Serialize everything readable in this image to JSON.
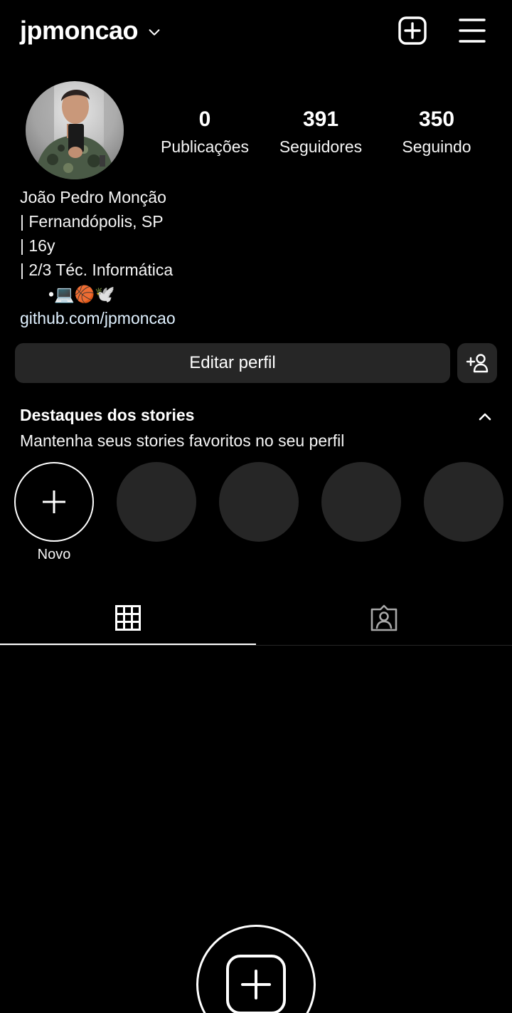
{
  "header": {
    "username": "jpmoncao",
    "icons": {
      "switch": "chevron-down-icon",
      "new_post": "add-square-icon",
      "menu": "hamburger-menu-icon"
    }
  },
  "profile": {
    "avatar": "profile-photo",
    "stats": {
      "posts": {
        "value": "0",
        "label": "Publicações"
      },
      "followers": {
        "value": "391",
        "label": "Seguidores"
      },
      "following": {
        "value": "350",
        "label": "Seguindo"
      }
    },
    "bio": {
      "name": "João Pedro Monção",
      "lines": [
        "| Fernandópolis, SP",
        "| 16y",
        "| 2/3 Téc. Informática",
        "•💻🏀🕊️"
      ],
      "link": "github.com/jpmoncao"
    }
  },
  "actions": {
    "edit_profile": "Editar perfil",
    "discover_icon": "add-person-icon"
  },
  "highlights": {
    "title": "Destaques dos stories",
    "subtitle": "Mantenha seus stories favoritos no seu perfil",
    "new_label": "Novo",
    "placeholders": 4
  },
  "tabs": [
    {
      "name": "posts",
      "icon": "grid-icon",
      "active": true
    },
    {
      "name": "tagged",
      "icon": "tagged-person-icon",
      "active": false
    }
  ],
  "colors": {
    "background": "#000000",
    "surface": "#262626",
    "text": "#f5f5f5",
    "link": "#e0f1ff"
  }
}
